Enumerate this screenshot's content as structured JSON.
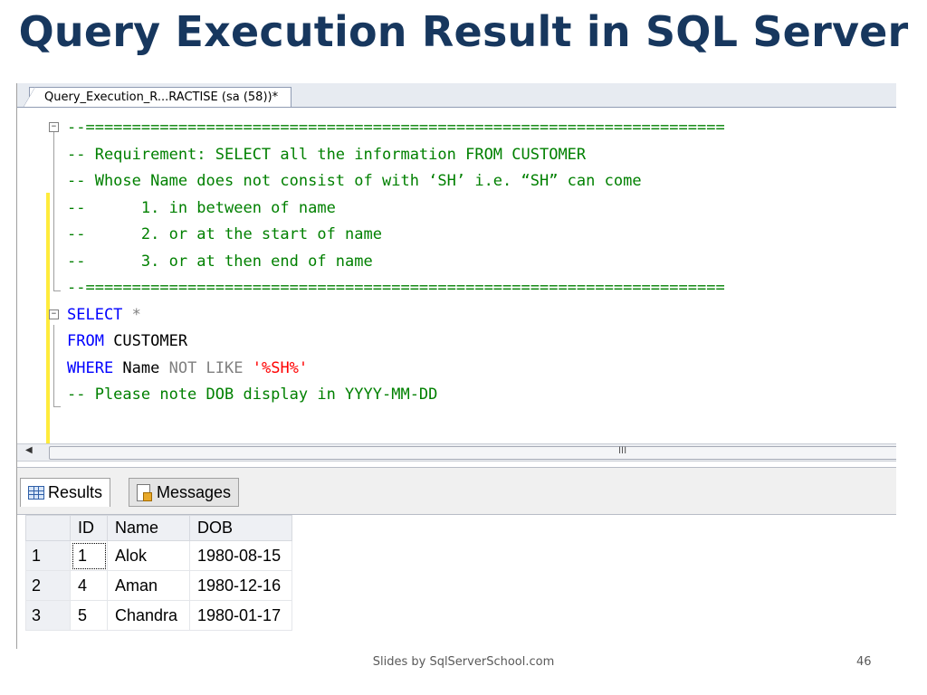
{
  "slide": {
    "title": "Query Execution Result in SQL Server",
    "footer": "Slides by SqlServerSchool.com",
    "page_number": "46"
  },
  "editor": {
    "tab_label": "Query_Execution_R...RACTISE (sa (58))*",
    "comment_block": [
      "--=====================================================================",
      "-- Requirement: SELECT all the information FROM CUSTOMER",
      "-- Whose Name does not consist of with ‘SH’ i.e. “SH” can come",
      "--      1. in between of name",
      "--      2. or at the start of name",
      "--      3. or at then end of name",
      "--====================================================================="
    ],
    "query": {
      "select_kw": "SELECT",
      "select_rest": " *",
      "from_kw": "FROM",
      "from_rest": " CUSTOMER",
      "where_kw": "WHERE",
      "where_col": " Name ",
      "not_like": "NOT LIKE",
      "pattern": " '%SH%'",
      "note": "-- Please note DOB display in YYYY-MM-DD"
    },
    "scroll_grip": "III"
  },
  "results": {
    "tabs": [
      {
        "label": "Results",
        "icon": "grid-icon",
        "active": true
      },
      {
        "label": "Messages",
        "icon": "messages-icon",
        "active": false
      }
    ],
    "columns": [
      "ID",
      "Name",
      "DOB"
    ],
    "rows": [
      {
        "row": "1",
        "id": "1",
        "name": "Alok",
        "dob": "1980-08-15"
      },
      {
        "row": "2",
        "id": "4",
        "name": "Aman",
        "dob": "1980-12-16"
      },
      {
        "row": "3",
        "id": "5",
        "name": "Chandra",
        "dob": "1980-01-17"
      }
    ]
  },
  "colors": {
    "title": "#17375e",
    "comment": "#008000",
    "keyword": "#0000ff",
    "string": "#ff0000",
    "change_bar": "#ffeb3b"
  }
}
